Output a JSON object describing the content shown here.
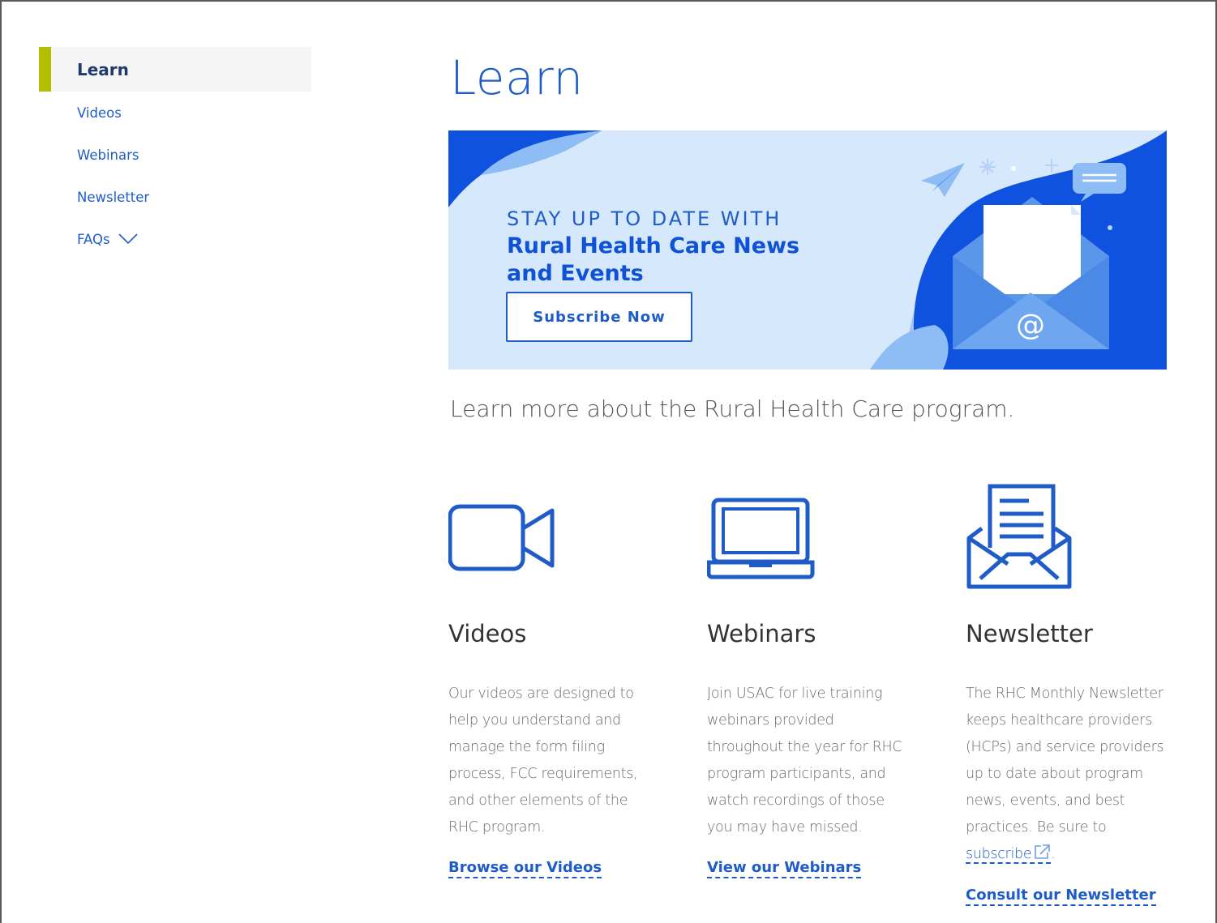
{
  "sidebar": {
    "active": "Learn",
    "items": [
      {
        "label": "Videos"
      },
      {
        "label": "Webinars"
      },
      {
        "label": "Newsletter"
      },
      {
        "label": "FAQs"
      }
    ]
  },
  "main": {
    "title": "Learn",
    "banner": {
      "kicker": "STAY UP TO DATE WITH",
      "headline": "Rural Health Care News and Events",
      "button": "Subscribe Now"
    },
    "intro": "Learn more about the Rural Health Care program.",
    "cards": [
      {
        "icon": "video-camera-icon",
        "title": "Videos",
        "text": "Our videos are designed to help you understand and manage the form filing process, FCC requirements, and other elements of the RHC program.",
        "link": "Browse our Videos"
      },
      {
        "icon": "laptop-icon",
        "title": "Webinars",
        "text": "Join USAC for live training webinars provided throughout the year for RHC program participants, and watch recordings of those you may have missed.",
        "link": "View our Webinars"
      },
      {
        "icon": "envelope-letter-icon",
        "title": "Newsletter",
        "text": "The RHC Monthly Newsletter keeps healthcare providers (HCPs) and service providers up to date about program news, events, and best practices. Be sure to",
        "inline_link": "subscribe",
        "text_end": ".",
        "link": "Consult our Newsletter"
      }
    ]
  },
  "colors": {
    "brand_blue": "#1f5cc8",
    "accent_bar": "#b5bd00",
    "banner_bg": "#d6e8fb"
  }
}
